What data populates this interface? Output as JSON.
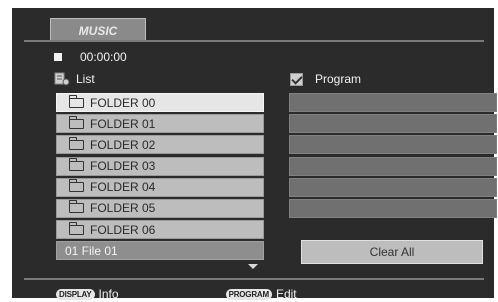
{
  "tab": {
    "label": "MUSIC"
  },
  "status": {
    "time": "00:00:00"
  },
  "list": {
    "title": "List",
    "items": [
      {
        "type": "folder",
        "label": "FOLDER 00",
        "selected": true
      },
      {
        "type": "folder",
        "label": "FOLDER 01",
        "selected": false
      },
      {
        "type": "folder",
        "label": "FOLDER 02",
        "selected": false
      },
      {
        "type": "folder",
        "label": "FOLDER 03",
        "selected": false
      },
      {
        "type": "folder",
        "label": "FOLDER 04",
        "selected": false
      },
      {
        "type": "folder",
        "label": "FOLDER 05",
        "selected": false
      },
      {
        "type": "folder",
        "label": "FOLDER 06",
        "selected": false
      },
      {
        "type": "file",
        "label": "01 File 01",
        "selected": false
      }
    ]
  },
  "program": {
    "title": "Program",
    "slots": [
      "",
      "",
      "",
      "",
      "",
      ""
    ],
    "clear_all_label": "Clear All"
  },
  "footer": {
    "display_key": "DISPLAY",
    "display_action": "Info",
    "program_key": "PROGRAM",
    "program_action": "Edit"
  },
  "colors": {
    "screen_bg": "#2b2b2b",
    "row_bg": "#bdbdbd",
    "row_selected_bg": "#e6e6e6",
    "program_slot_bg": "#707070"
  }
}
